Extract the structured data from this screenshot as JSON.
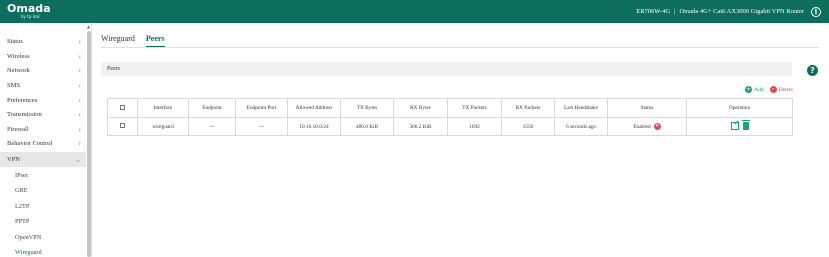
{
  "header": {
    "logo": "Omada",
    "logo_sub": "by tp-link",
    "model": "ER706W-4G",
    "description": "Omada 4G+ Cat6 AX3000 Gigabit VPN Router",
    "brand_color": "#0e6e5d"
  },
  "sidebar": {
    "items": [
      {
        "label": "Status"
      },
      {
        "label": "Wireless"
      },
      {
        "label": "Network"
      },
      {
        "label": "SMS"
      },
      {
        "label": "Preferences"
      },
      {
        "label": "Transmission"
      },
      {
        "label": "Firewall"
      },
      {
        "label": "Behavior Control"
      },
      {
        "label": "VPN"
      }
    ],
    "vpn_sub_items": [
      {
        "label": "IPsec"
      },
      {
        "label": "GRE"
      },
      {
        "label": "L2TP"
      },
      {
        "label": "PPTP"
      },
      {
        "label": "OpenVPN"
      },
      {
        "label": "Wireguard"
      }
    ]
  },
  "tabs": [
    {
      "label": "Wireguard"
    },
    {
      "label": "Peers"
    }
  ],
  "section_title": "Peers",
  "actions": {
    "add": "Add",
    "delete": "Delete"
  },
  "table": {
    "columns": [
      "Interface",
      "Endpoint",
      "Endpoint Port",
      "Allowed Address",
      "TX Bytes",
      "RX Bytes",
      "TX Packets",
      "RX Packets",
      "Last Handshake",
      "Status",
      "Operation"
    ],
    "rows": [
      {
        "interface": "wireguard",
        "endpoint": "---",
        "endpoint_port": "---",
        "allowed_address": "10.10.10.0/24",
        "tx_bytes": "486.0 KiB",
        "rx_bytes": "366.2 KiB",
        "tx_packets": "1692",
        "rx_packets": "1550",
        "last_handshake": "6 seconds ago",
        "status": "Enabled"
      }
    ]
  }
}
